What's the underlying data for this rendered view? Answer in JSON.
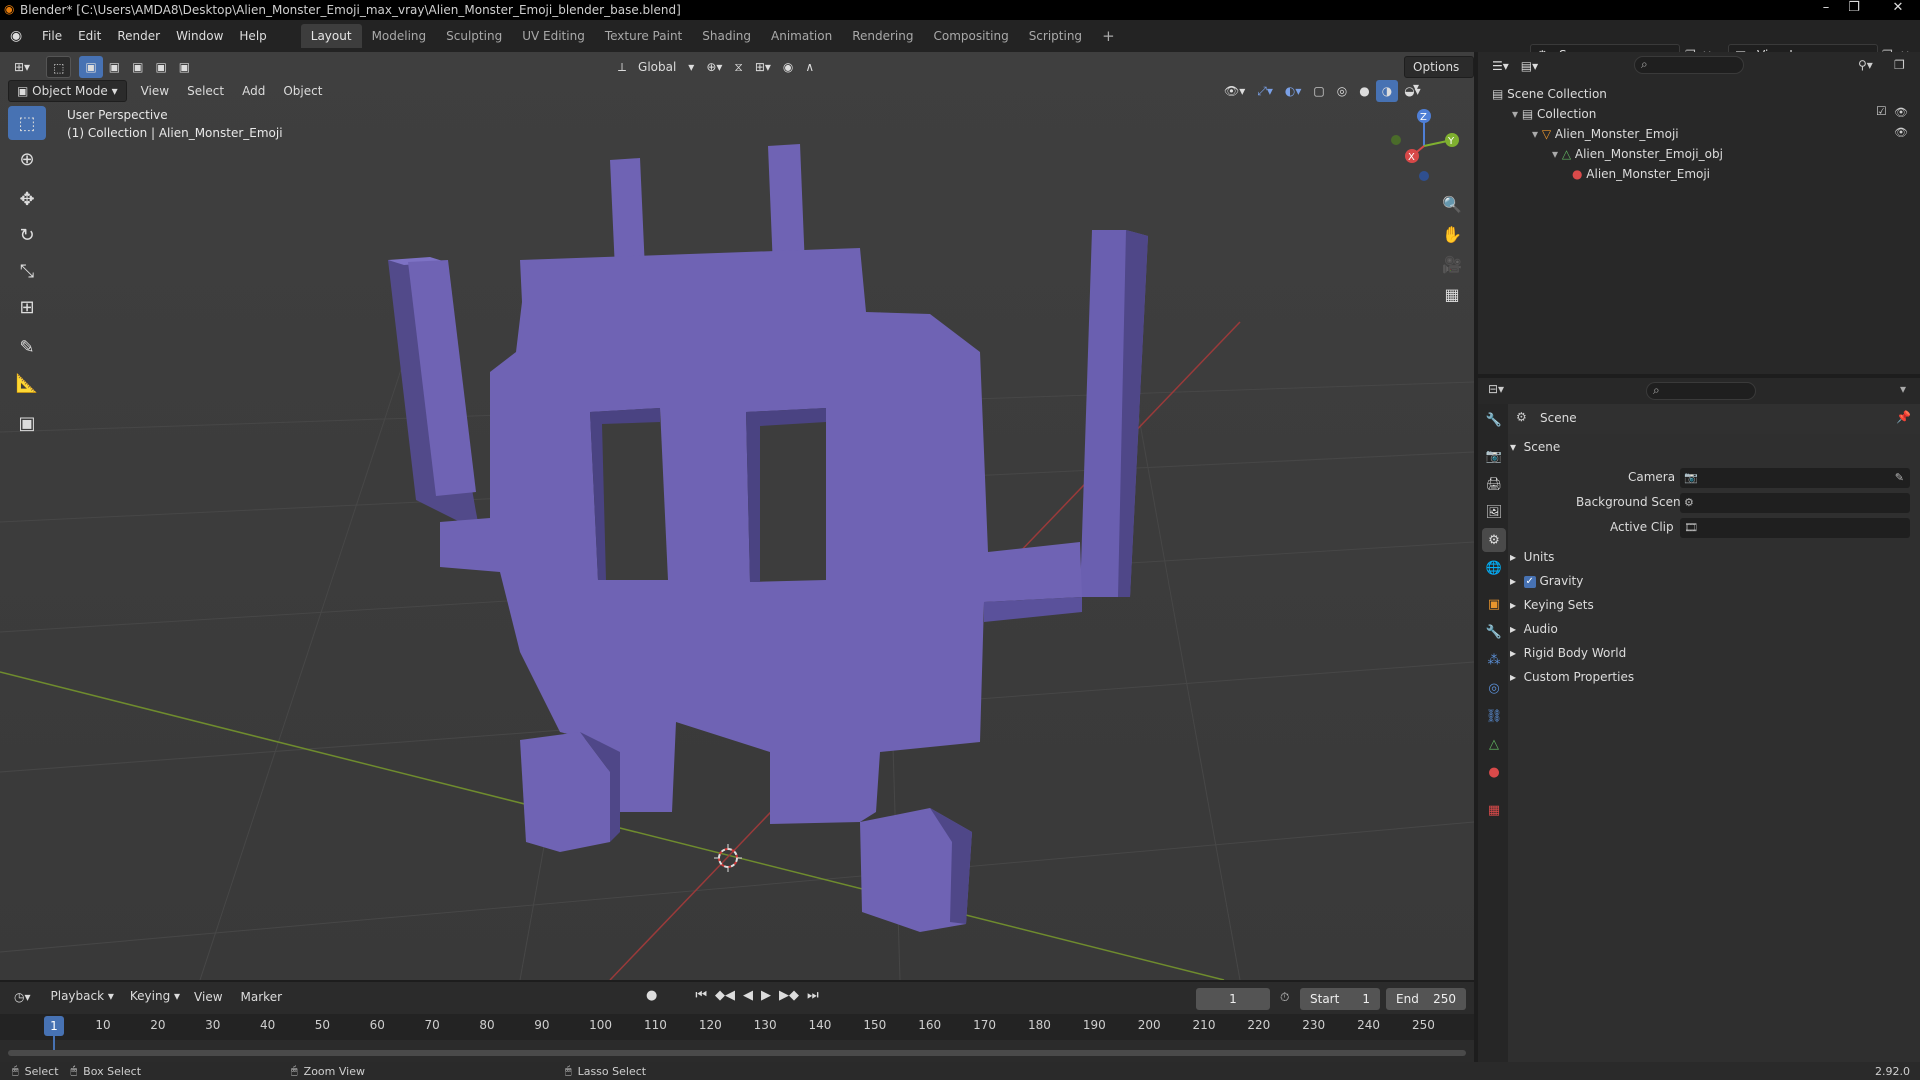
{
  "window": {
    "title": "Blender* [C:\\Users\\AMDA8\\Desktop\\Alien_Monster_Emoji_max_vray\\Alien_Monster_Emoji_blender_base.blend]",
    "minimize": "–",
    "maximize": "❐",
    "close": "✕"
  },
  "menu": {
    "items": [
      "File",
      "Edit",
      "Render",
      "Window",
      "Help"
    ]
  },
  "workspaces": {
    "tabs": [
      "Layout",
      "Modeling",
      "Sculpting",
      "UV Editing",
      "Texture Paint",
      "Shading",
      "Animation",
      "Rendering",
      "Compositing",
      "Scripting"
    ],
    "add": "+"
  },
  "scene_selector": {
    "value": "Scene"
  },
  "viewlayer_selector": {
    "value": "View Layer"
  },
  "viewport": {
    "transform_orientation": "Global",
    "options": "Options",
    "mode": "Object Mode",
    "menus": [
      "View",
      "Select",
      "Add",
      "Object"
    ],
    "perspective_label": "User Perspective",
    "collection_label": "(1) Collection | Alien_Monster_Emoji",
    "gizmo": {
      "x": "X",
      "y": "Y",
      "z": "Z"
    },
    "object_color": "#6f63b4"
  },
  "timeline": {
    "menus": [
      "Playback",
      "Keying",
      "View",
      "Marker"
    ],
    "current_frame": "1",
    "start_label": "Start",
    "start_value": "1",
    "end_label": "End",
    "end_value": "250",
    "ticks": [
      "1",
      "10",
      "20",
      "30",
      "40",
      "50",
      "60",
      "70",
      "80",
      "90",
      "100",
      "110",
      "120",
      "130",
      "140",
      "150",
      "160",
      "170",
      "180",
      "190",
      "200",
      "210",
      "220",
      "230",
      "240",
      "250"
    ]
  },
  "outliner": {
    "rows": [
      {
        "label": "Scene Collection",
        "level": 0
      },
      {
        "label": "Collection",
        "level": 1
      },
      {
        "label": "Alien_Monster_Emoji",
        "level": 2
      },
      {
        "label": "Alien_Monster_Emoji_obj",
        "level": 3
      },
      {
        "label": "Alien_Monster_Emoji",
        "level": 4
      }
    ]
  },
  "properties": {
    "context": "Scene",
    "panel": "Scene",
    "fields": {
      "camera": "Camera",
      "background_scene": "Background Scene",
      "active_clip": "Active Clip"
    },
    "subpanels": [
      "Units",
      "Gravity",
      "Keying Sets",
      "Audio",
      "Rigid Body World",
      "Custom Properties"
    ]
  },
  "status": {
    "select": "Select",
    "box_select": "Box Select",
    "zoom_view": "Zoom View",
    "lasso_select": "Lasso Select",
    "version": "2.92.0"
  }
}
